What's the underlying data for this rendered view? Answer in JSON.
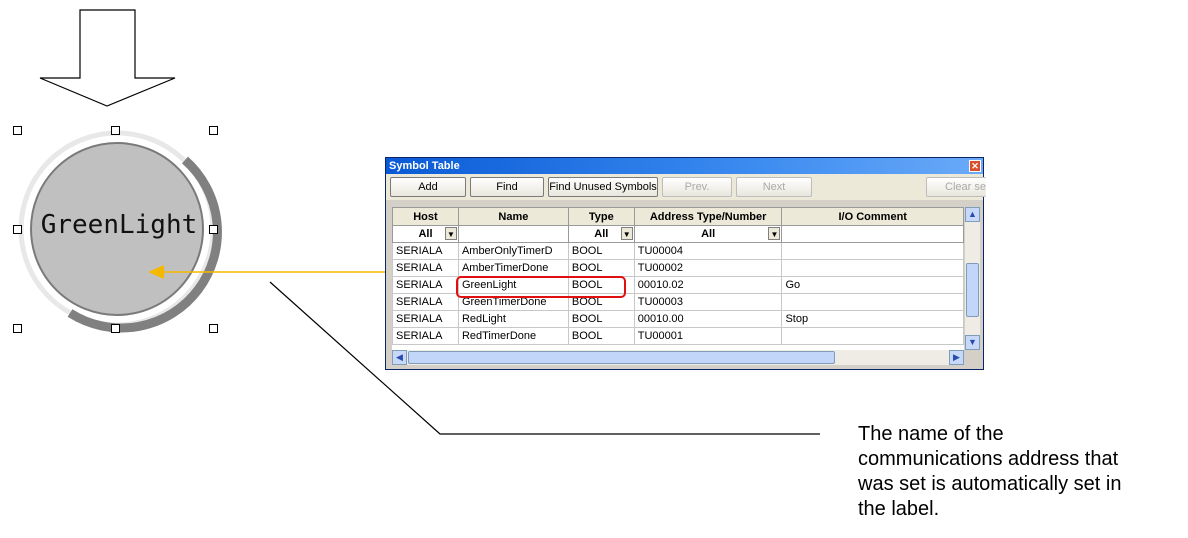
{
  "lamp": {
    "label": "GreenLight"
  },
  "symbol_table": {
    "title": "Symbol Table",
    "close_icon": "close-icon",
    "toolbar": {
      "add": "Add",
      "find": "Find",
      "find_unused": "Find Unused Symbols",
      "prev": "Prev.",
      "next": "Next",
      "clear": "Clear se"
    },
    "columns": [
      "Host",
      "Name",
      "Type",
      "Address Type/Number",
      "I/O Comment"
    ],
    "filters": {
      "host": "All",
      "type": "All",
      "address": "All"
    },
    "rows": [
      {
        "host": "SERIALA",
        "name": "AmberOnlyTimerD",
        "type": "BOOL",
        "address": "TU00004",
        "comment": ""
      },
      {
        "host": "SERIALA",
        "name": "AmberTimerDone",
        "type": "BOOL",
        "address": "TU00002",
        "comment": ""
      },
      {
        "host": "SERIALA",
        "name": "GreenLight",
        "type": "BOOL",
        "address": "00010.02",
        "comment": "Go"
      },
      {
        "host": "SERIALA",
        "name": "GreenTimerDone",
        "type": "BOOL",
        "address": "TU00003",
        "comment": ""
      },
      {
        "host": "SERIALA",
        "name": "RedLight",
        "type": "BOOL",
        "address": "00010.00",
        "comment": "Stop"
      },
      {
        "host": "SERIALA",
        "name": "RedTimerDone",
        "type": "BOOL",
        "address": "TU00001",
        "comment": ""
      }
    ],
    "selected_row": 2
  },
  "caption": "The name of the\ncommunications address that\nwas set is automatically set in\nthe label.",
  "colors": {
    "arrow": "#f5b800",
    "highlight": "#e01010",
    "lamp_fill": "#c0c0c0",
    "lamp_ring": "#808080"
  }
}
